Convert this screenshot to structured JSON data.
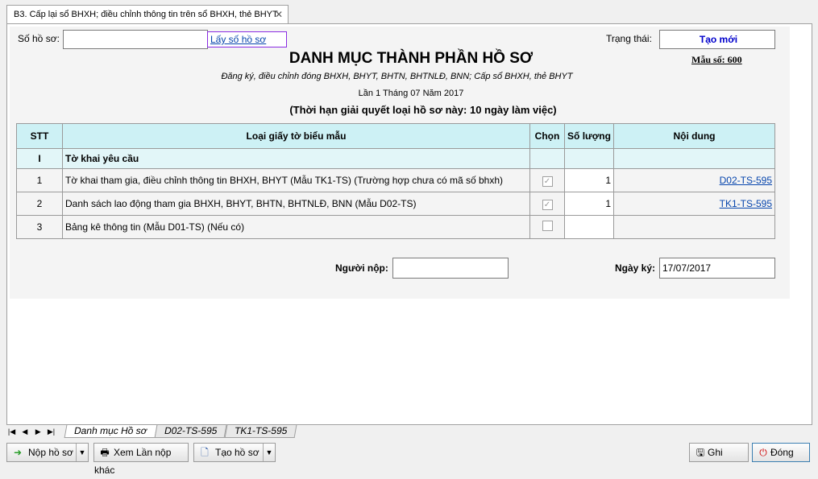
{
  "tab": {
    "title": "B3. Cấp lại sổ BHXH; điều chỉnh thông tin trên sổ BHXH, thẻ BHYT",
    "close": "✕"
  },
  "form": {
    "so_ho_so_label": "Số hồ sơ:",
    "so_ho_so_value": "",
    "lay_so_ho_so": "Lấy số hồ sơ",
    "trang_thai_label": "Trạng thái:",
    "trang_thai_value": "Tạo mới",
    "title": "DANH MỤC THÀNH PHẦN HỒ SƠ",
    "mau_so": "Mẫu số: 600",
    "subtitle": "Đăng ký, điều chỉnh đóng BHXH, BHYT, BHTN, BHTNLĐ, BNN; Cấp sổ BHXH, thẻ BHYT",
    "lan": "Lần 1 Tháng 07 Năm 2017",
    "thoi_han": "(Thời hạn giải quyết loại hồ sơ này: 10 ngày làm việc)",
    "nguoi_nop_label": "Người nộp:",
    "nguoi_nop_value": "",
    "ngay_ky_label": "Ngày ký:",
    "ngay_ky_value": "17/07/2017"
  },
  "table": {
    "headers": [
      "STT",
      "Loại giấy tờ biểu mẫu",
      "Chọn",
      "Số lượng",
      "Nội dung"
    ],
    "section": {
      "stt": "I",
      "name": "Tờ khai yêu cầu"
    },
    "rows": [
      {
        "stt": "1",
        "name": "Tờ khai tham gia, điều chỉnh thông tin BHXH, BHYT (Mẫu TK1-TS) (Trường hợp chưa có mã số bhxh)",
        "checked": "✓",
        "qty": "1",
        "content": "D02-TS-595"
      },
      {
        "stt": "2",
        "name": "Danh sách lao động tham gia BHXH, BHYT, BHTN, BHTNLĐ, BNN (Mẫu D02-TS)",
        "checked": "✓",
        "qty": "1",
        "content": "TK1-TS-595"
      },
      {
        "stt": "3",
        "name": "Bảng kê thông tin (Mẫu D01-TS) (Nếu có)",
        "checked": "",
        "qty": "",
        "content": ""
      }
    ]
  },
  "sheets": [
    "Danh mục Hồ sơ",
    "D02-TS-595",
    "TK1-TS-595"
  ],
  "toolbar": {
    "nop_ho_so": "Nộp hồ sơ",
    "xem_lan_nop": "Xem Lần nộp khác",
    "tao_ho_so": "Tạo hồ sơ",
    "ghi": "Ghi",
    "dong": "Đóng"
  },
  "colors": {
    "accent": "#0000cc",
    "header_bg": "#cdf1f5",
    "close_red": "#cc0000"
  }
}
